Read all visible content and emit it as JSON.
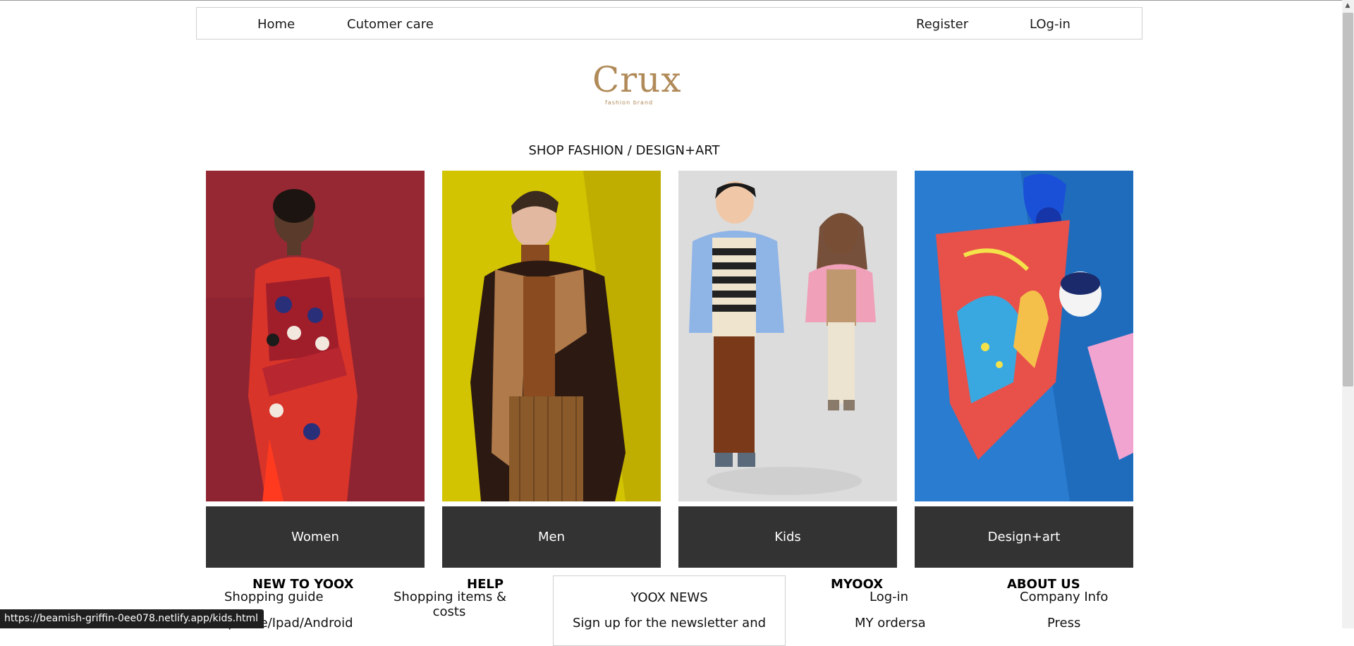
{
  "nav": {
    "home": "Home",
    "customer_care": "Cutomer care",
    "register": "Register",
    "login": "LOg-in"
  },
  "brand": {
    "name": "Crux",
    "tagline": "fashion brand",
    "color": "#b08a58"
  },
  "section_title": "SHOP FASHION / DESIGN+ART",
  "categories": [
    {
      "label": "Women"
    },
    {
      "label": "Men"
    },
    {
      "label": "Kids"
    },
    {
      "label": "Design+art"
    }
  ],
  "colors": {
    "button_bg": "#333333",
    "button_text": "#ffffff"
  },
  "footer": {
    "new_to_yoox": {
      "heading": "NEW TO YOOX",
      "links": [
        "Shopping guide",
        "Iphone/Ipad/Android"
      ]
    },
    "help": {
      "heading": "HELP",
      "links": [
        "Shopping items &",
        "costs"
      ]
    },
    "newsletter": {
      "title": "YOOX NEWS",
      "text": "Sign up for the newsletter and"
    },
    "myoox": {
      "heading": "MYOOX",
      "links": [
        "Log-in",
        "MY ordersa"
      ]
    },
    "about": {
      "heading": "ABOUT US",
      "links": [
        "Company Info",
        "Press"
      ]
    }
  },
  "status_bar_url": "https://beamish-griffin-0ee078.netlify.app/kids.html"
}
